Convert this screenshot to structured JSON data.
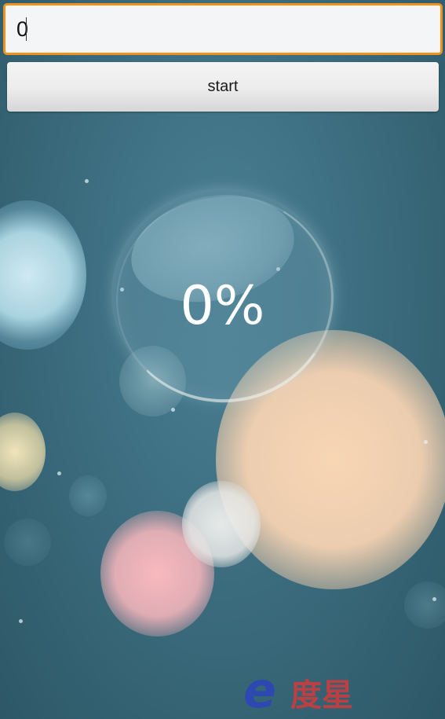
{
  "input": {
    "value": "0"
  },
  "start_button": {
    "label": "start"
  },
  "progress": {
    "percent_text": "0%"
  },
  "watermark": {
    "logo_letter": "e",
    "logo_text": "度星"
  },
  "colors": {
    "input_focus_border": "#f0921e",
    "background_teal": "#3a6878",
    "progress_text": "#ffffff",
    "logo_blue": "#2e45b8",
    "logo_red": "#d43a3a"
  }
}
